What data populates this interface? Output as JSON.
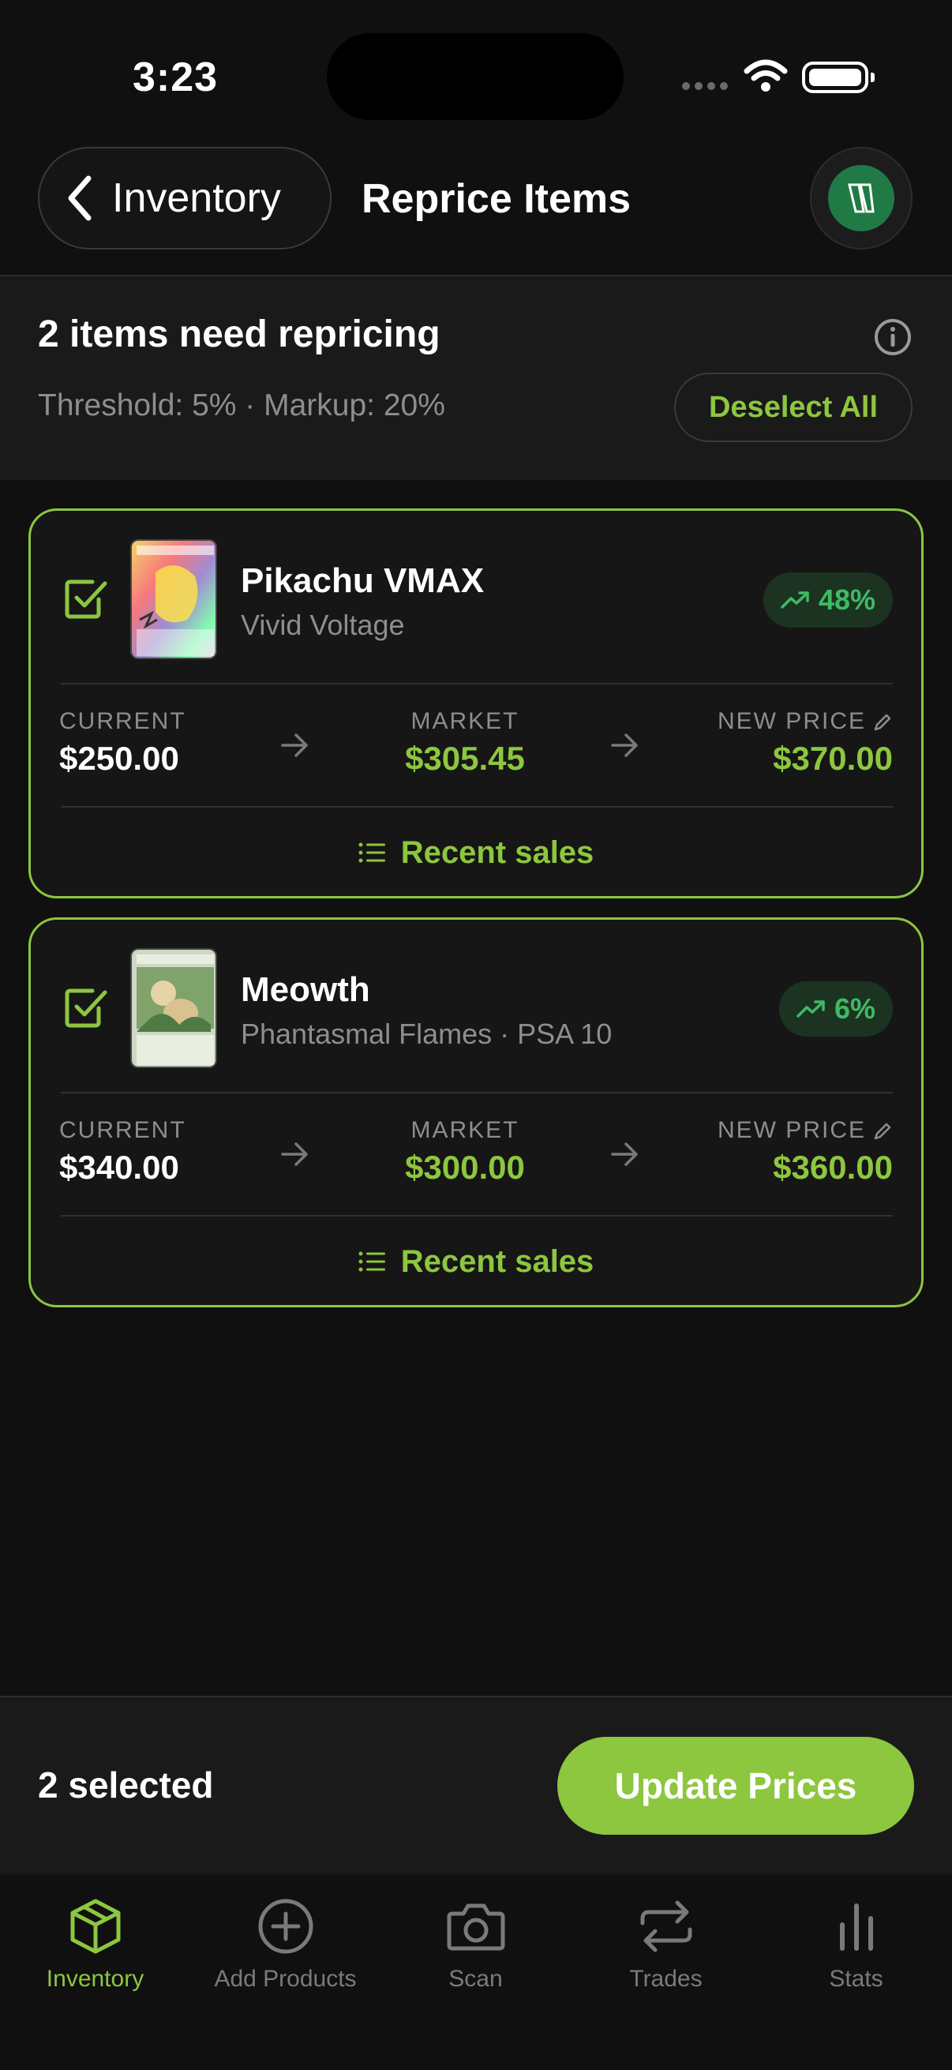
{
  "status_bar": {
    "time": "3:23"
  },
  "nav": {
    "back_label": "Inventory",
    "title": "Reprice Items"
  },
  "summary": {
    "title": "2 items need repricing",
    "subtitle": "Threshold: 5% · Markup: 20%",
    "deselect_label": "Deselect All"
  },
  "items": [
    {
      "name": "Pikachu VMAX",
      "set": "Vivid Voltage",
      "trend": "48%",
      "current_label": "CURRENT",
      "current": "$250.00",
      "market_label": "MARKET",
      "market": "$305.45",
      "new_label": "NEW PRICE",
      "new_price": "$370.00",
      "recent_sales_label": "Recent sales",
      "checked": true
    },
    {
      "name": "Meowth",
      "set": "Phantasmal Flames · PSA 10",
      "trend": "6%",
      "current_label": "CURRENT",
      "current": "$340.00",
      "market_label": "MARKET",
      "market": "$300.00",
      "new_label": "NEW PRICE",
      "new_price": "$360.00",
      "recent_sales_label": "Recent sales",
      "checked": true
    }
  ],
  "footer": {
    "selected": "2 selected",
    "update_label": "Update Prices"
  },
  "tabs": [
    {
      "label": "Inventory",
      "icon": "cube-icon",
      "active": true
    },
    {
      "label": "Add Products",
      "icon": "plus-circle-icon",
      "active": false
    },
    {
      "label": "Scan",
      "icon": "camera-icon",
      "active": false
    },
    {
      "label": "Trades",
      "icon": "swap-icon",
      "active": false
    },
    {
      "label": "Stats",
      "icon": "bar-chart-icon",
      "active": false
    }
  ],
  "colors": {
    "accent": "#8dc63f",
    "trend_green": "#3fba64",
    "background": "#101010",
    "card": "#161616"
  }
}
